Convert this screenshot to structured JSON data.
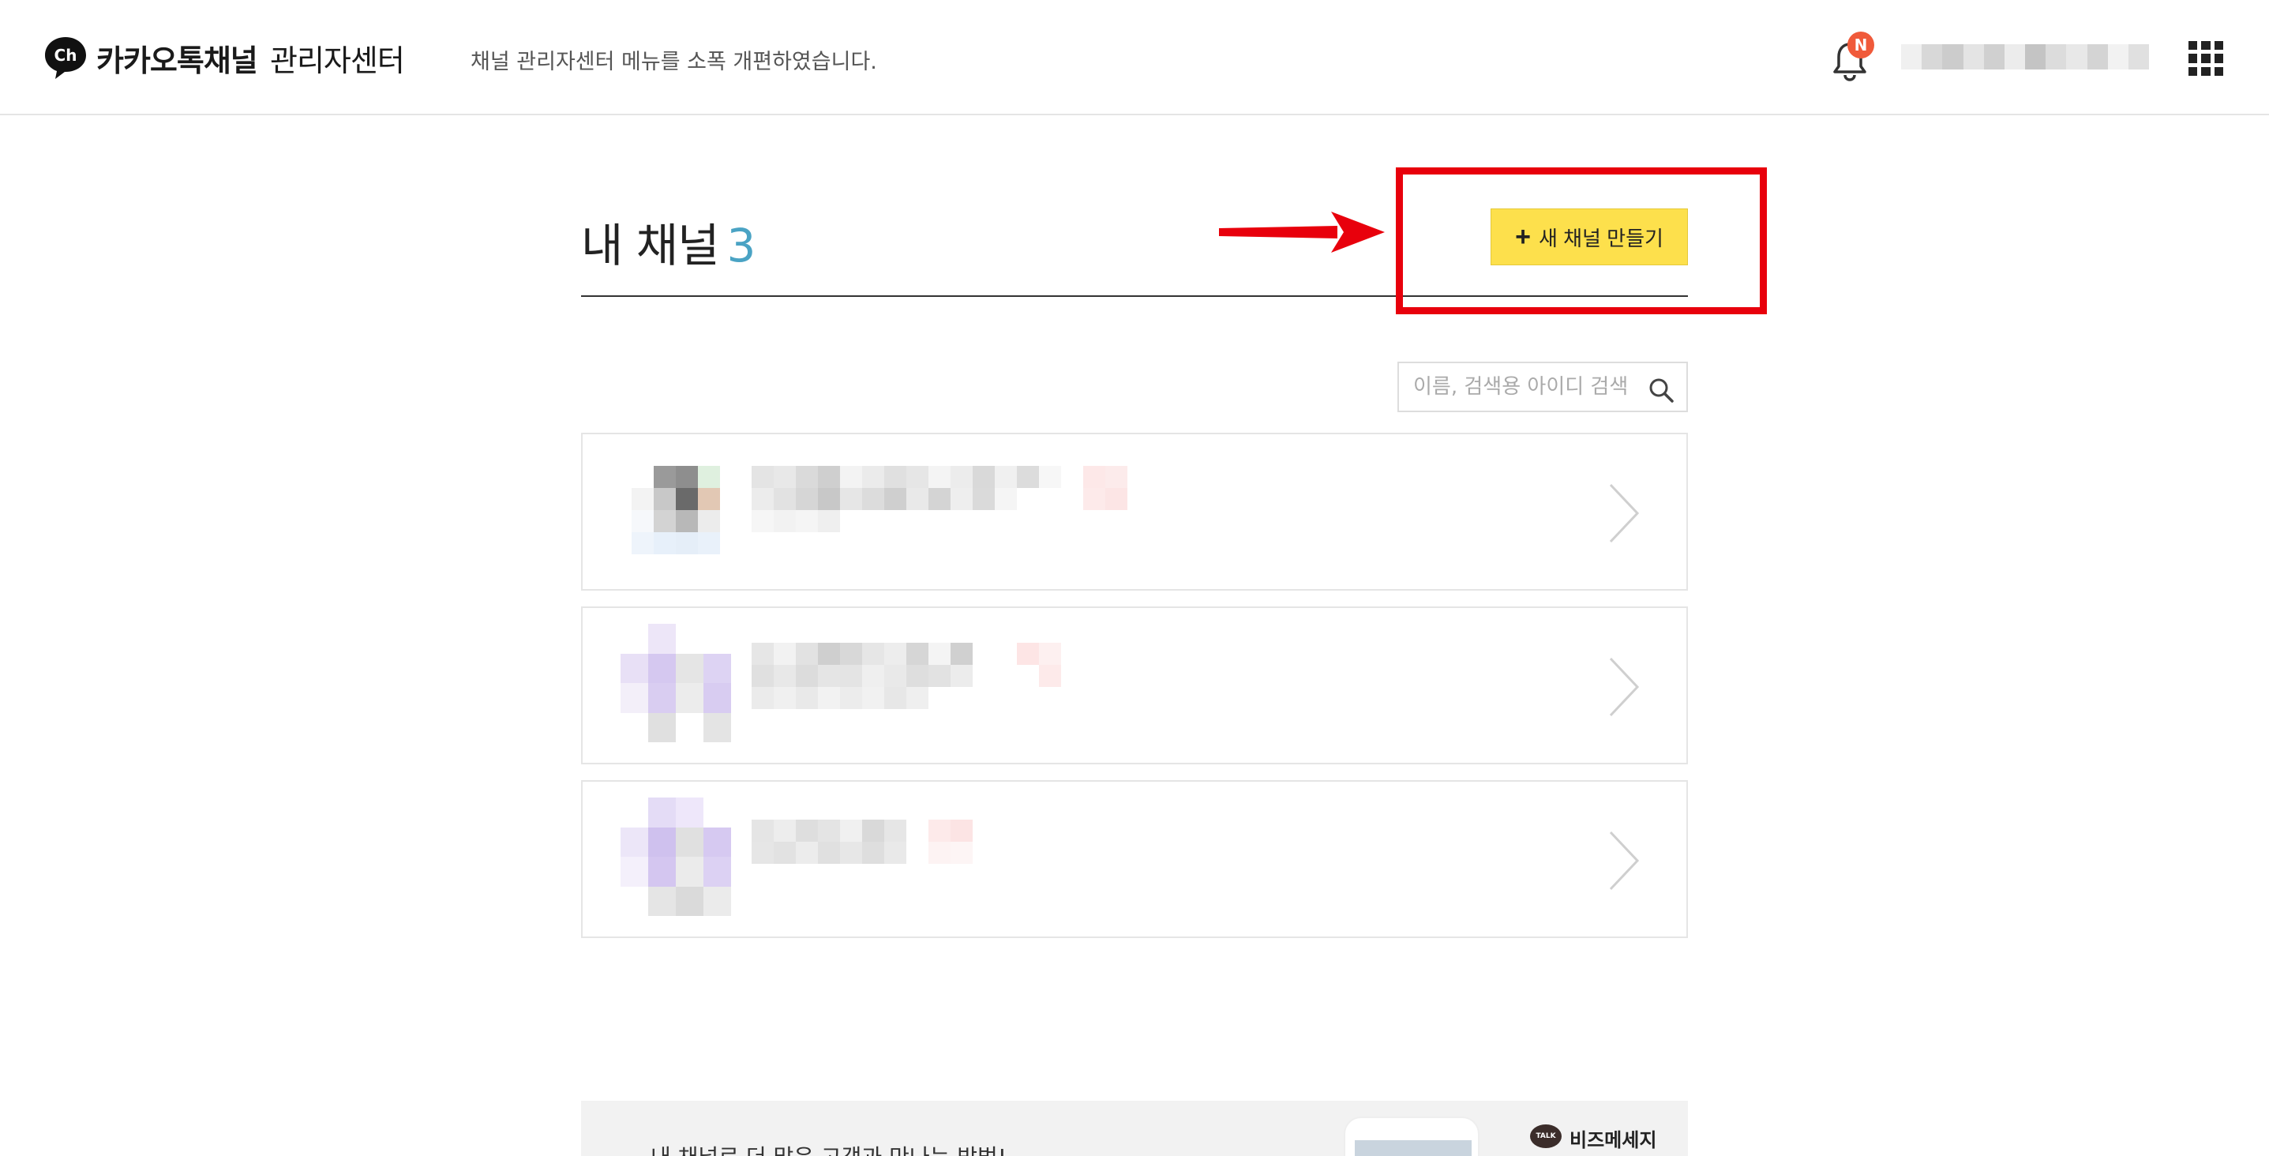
{
  "header": {
    "logo_badge": "Ch",
    "logo_text": "카카오톡채널",
    "logo_sub": "관리자센터",
    "notice": "채널 관리자센터 메뉴를 소폭 개편하였습니다.",
    "notification_badge": "N",
    "account_name": ""
  },
  "main": {
    "title": "내 채널",
    "channel_count": "3",
    "new_channel_button": "새 채널 만들기",
    "search_placeholder": "이름, 검색용 아이디 검색",
    "search_value": ""
  },
  "channels": [
    {
      "name": "",
      "id": "",
      "tag": ""
    },
    {
      "name": "",
      "id": "",
      "tag": ""
    },
    {
      "name": "",
      "id": "",
      "tag": ""
    }
  ],
  "banner": {
    "text": "내 채널로 더 많은 고객과 만나는 방법!",
    "biz_logo": "TALK",
    "biz_label": "비즈메세지"
  },
  "colors": {
    "accent_button": "#fde04c",
    "count": "#4aa3c4",
    "highlight": "#e8000c",
    "badge": "#f05a3a"
  }
}
